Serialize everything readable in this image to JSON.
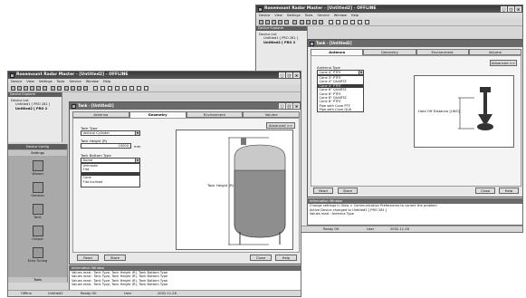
{
  "back_window": {
    "title": "Rosemount Radar Master - [Untitled2] - OFFLINE",
    "menu": [
      "Device",
      "View",
      "Settings",
      "Tools",
      "Service",
      "Window",
      "Help"
    ],
    "device_explorer": {
      "title": "Device Explorer",
      "root": "Device List",
      "items": [
        "Untitled1 [ PRO 281 ]",
        "Untitled2 [ PRO 2"
      ]
    },
    "child": {
      "title": "Tank - [Untitled2]",
      "tabs": [
        "Antenna",
        "Geometry",
        "Environment",
        "Volume"
      ],
      "active_tab": "Antenna",
      "advanced": "Advanced >>",
      "antenna_type_label": "Antenna Type",
      "antenna_type_value": "Cone 4\" PTFE",
      "antenna_options": [
        "Cone 3\" PTFE",
        "Cone 4\" QUARTZ",
        "Cone 4\" PTFE",
        "Cone 6\" QUARTZ",
        "Cone 6\" PTFE",
        "Cone 8\" QUARTZ",
        "Cone 8\" PTFE",
        "Pipe with Cone PTF",
        "Pipe with Cone QUA"
      ],
      "antenna_highlight_index": 2,
      "drawing_label": "Hold Off Distance [UNO]",
      "read_button": "Read",
      "store_button": "Store",
      "close_button": "Close",
      "help_button": "Help"
    },
    "info": {
      "title": "Information Window",
      "lines": [
        "Change settings in View > Communication Preferences to correct the problem",
        "Active Device changed to Untitled2 [ PRO 281 ]",
        "Values read : Antenna Type"
      ]
    },
    "status": {
      "state": "Ready OK",
      "user": "User",
      "date": "2002-11-26"
    }
  },
  "front_window": {
    "title": "Rosemount Radar Master - [Untitled2] - OFFLINE",
    "menu": [
      "Device",
      "View",
      "Settings",
      "Tools",
      "Service",
      "Window",
      "Help"
    ],
    "device_explorer": {
      "title": "Device Explorer",
      "root": "Device List",
      "items": [
        "Untitled1 [ PRO 281 ]",
        "Untitled2 [ PRO 2"
      ]
    },
    "navigator": {
      "title": "Device Config",
      "settings": "Settings",
      "buttons": [
        "Wizard",
        "General",
        "Tank",
        "Output",
        "Echo Tuning"
      ],
      "tools": "Tools"
    },
    "child": {
      "title": "Tank - [Untitled2]",
      "tabs": [
        "Antenna",
        "Geometry",
        "Environment",
        "Volume"
      ],
      "active_tab": "Geometry",
      "advanced": "Advanced >>",
      "tank_type_label": "Tank Type",
      "tank_type_value": "Vertical Cylinder",
      "tank_height_label": "Tank Height (R)",
      "tank_height_value": "10000",
      "tank_height_unit": "mm",
      "bottom_type_label": "Tank Bottom Type",
      "bottom_type_value": "Dome",
      "bottom_options": [
        "Unknown",
        "Flat",
        "Cone",
        "Flat Inclined"
      ],
      "bottom_highlight_index": 2,
      "drawing_label": "Tank Height (R)",
      "read_button": "Read",
      "store_button": "Store",
      "close_button": "Close",
      "help_button": "Help"
    },
    "info": {
      "title": "Information Window",
      "lines": [
        "Values read : Tank Type, Tank Height (R), Tank Bottom Type",
        "Values read : Tank Type, Tank Height (R), Tank Bottom Type",
        "Values read : Tank Type, Tank Height (R), Tank Bottom Type",
        "Values read : Tank Type, Tank Height (R), Tank Bottom Type"
      ]
    },
    "status": {
      "mode": "Offline",
      "device": "Untitled2",
      "state": "Ready OK",
      "user": "User",
      "date": "2002-11-26"
    }
  }
}
